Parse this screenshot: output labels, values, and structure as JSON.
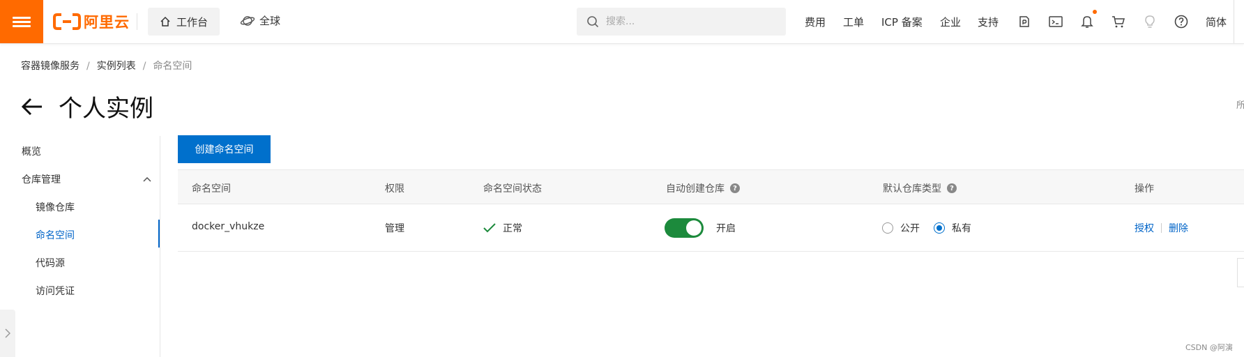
{
  "topbar": {
    "logo_text": "阿里云",
    "workbench": "工作台",
    "region": "全球",
    "search_placeholder": "搜索...",
    "links": [
      "费用",
      "工单",
      "ICP 备案",
      "企业",
      "支持"
    ],
    "language": "简体"
  },
  "breadcrumb": [
    "容器镜像服务",
    "实例列表",
    "命名空间"
  ],
  "page_title": "个人实例",
  "edge_char": "所",
  "sidebar": {
    "overview": "概览",
    "repo_mgmt": "仓库管理",
    "items": [
      "镜像仓库",
      "命名空间",
      "代码源",
      "访问凭证"
    ]
  },
  "create_button": "创建命名空间",
  "table": {
    "headers": [
      "命名空间",
      "权限",
      "命名空间状态",
      "自动创建仓库",
      "默认仓库类型",
      "操作"
    ],
    "row": {
      "namespace": "docker_vhukze",
      "permission": "管理",
      "status": "正常",
      "auto_create": "开启",
      "type_public": "公开",
      "type_private": "私有",
      "action_auth": "授权",
      "action_delete": "删除"
    }
  },
  "watermark": "CSDN @阿演",
  "colors": {
    "brand": "#ff6a00",
    "primary": "#0070cc",
    "toggle_on": "#1c8a3c"
  }
}
